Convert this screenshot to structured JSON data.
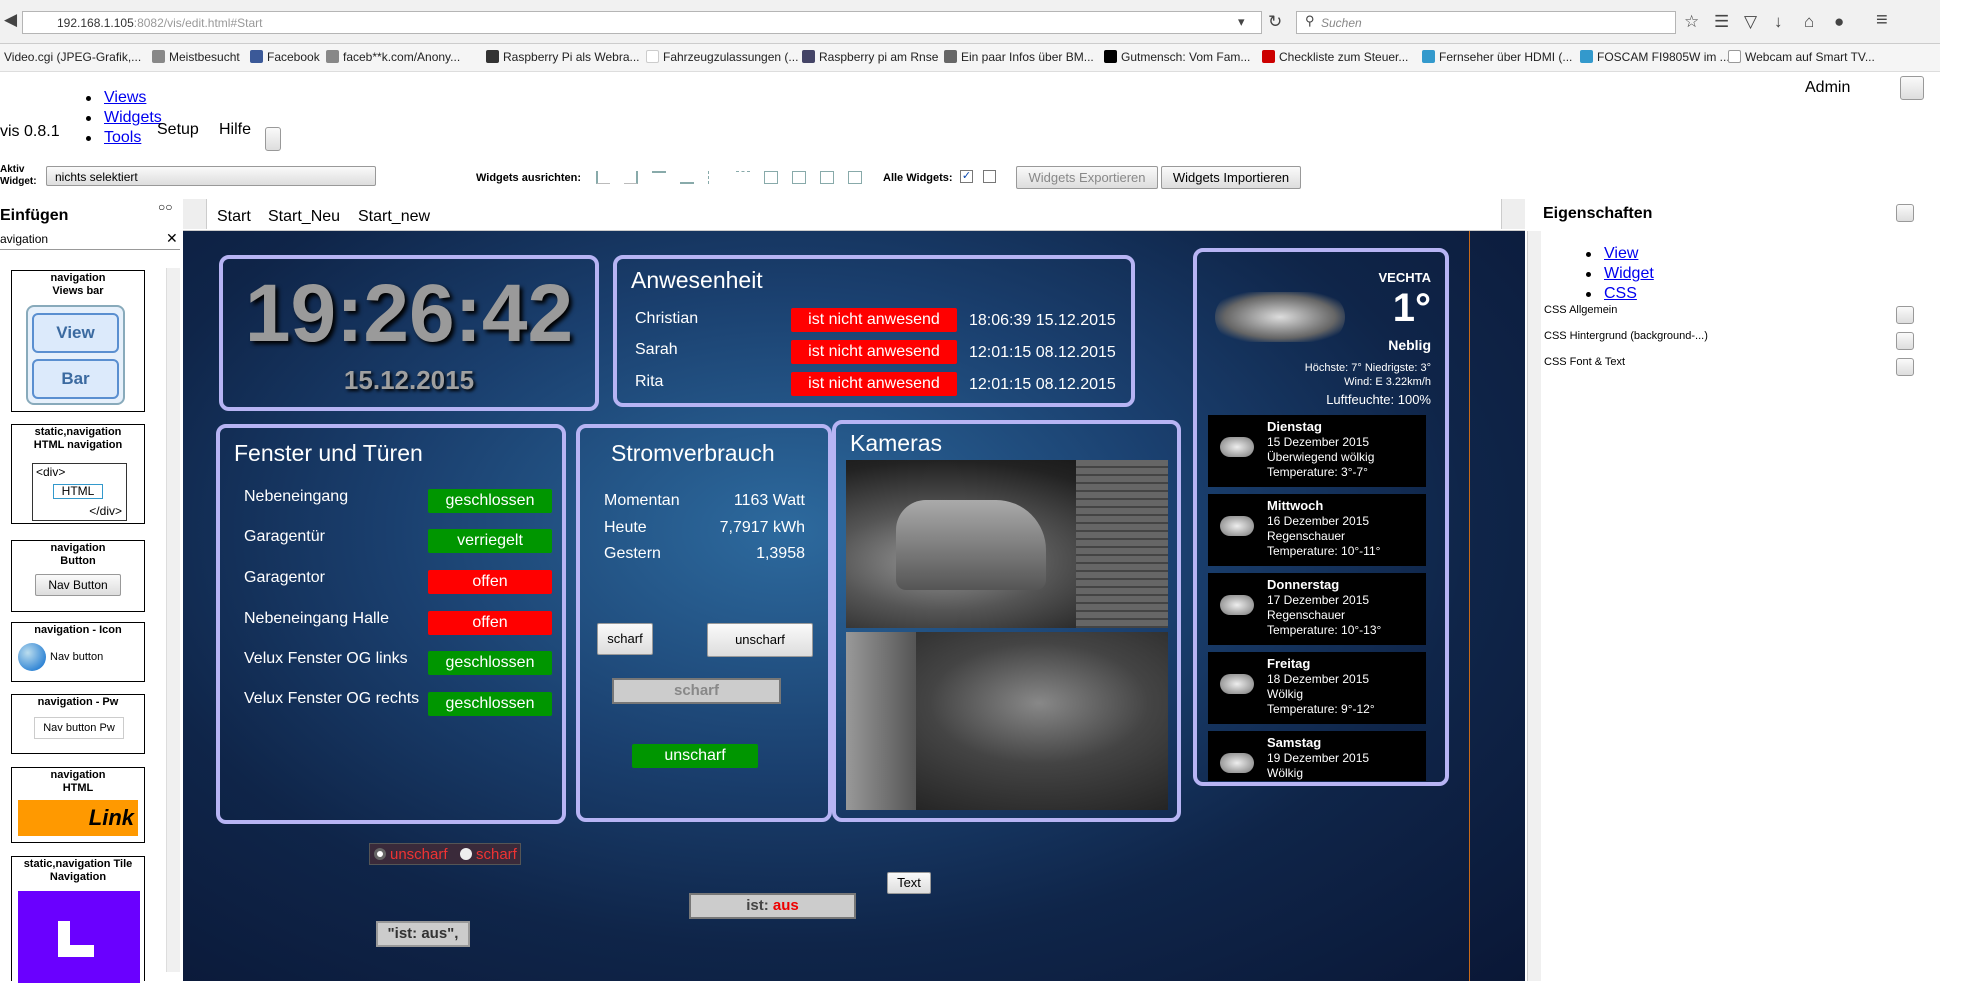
{
  "browser": {
    "url_host": "192.168.1.105",
    "url_rest": ":8082/vis/edit.html#Start",
    "search_placeholder": "Suchen",
    "bookmarks": [
      "Video.cgi (JPEG-Grafik,...",
      "Meistbesucht",
      "Facebook",
      "faceb**k.com/Anony...",
      "Raspberry Pi als Webra...",
      "Fahrzeugzulassungen (...",
      "Raspberry pi am Rnse",
      "Ein paar Infos über BM...",
      "Gutmensch: Vom Fam...",
      "Checkliste zum Steuer...",
      "Fernseher über HDMI (...",
      "FOSCAM FI9805W im ...",
      "Webcam auf Smart TV..."
    ]
  },
  "editor": {
    "menu": [
      "Views",
      "Widgets",
      "Tools"
    ],
    "version": "vis 0.8.1",
    "setup": "Setup",
    "hilfe": "Hilfe",
    "user": "Admin",
    "aktiv_label": "Aktiv Widget:",
    "aktiv_value": "nichts selektiert",
    "align_label": "Widgets ausrichten:",
    "alle_label": "Alle Widgets:",
    "export_btn": "Widgets Exportieren",
    "import_btn": "Widgets Importieren",
    "einfuegen": "Einfügen",
    "filter": "avigation",
    "view_tabs": [
      "Start",
      "Start_Neu",
      "Start_new"
    ]
  },
  "widgets_palette": [
    {
      "title": "navigation Views bar",
      "preview": [
        "View",
        "Bar"
      ]
    },
    {
      "title": "static,navigation HTML navigation",
      "preview": [
        "<div>",
        "HTML",
        "</div>"
      ]
    },
    {
      "title": "navigation Button",
      "preview": [
        "Nav Button"
      ]
    },
    {
      "title": "navigation - Icon",
      "preview": [
        "Nav button"
      ]
    },
    {
      "title": "navigation - Pw",
      "preview": [
        "Nav button Pw"
      ]
    },
    {
      "title": "navigation HTML",
      "preview": [
        "Link"
      ]
    },
    {
      "title": "static,navigation Tile Navigation",
      "preview": []
    }
  ],
  "properties": {
    "title": "Eigenschaften",
    "tabs": [
      "View",
      "Widget",
      "CSS"
    ],
    "groups": [
      "CSS Allgemein",
      "CSS Hintergrund (background-...)",
      "CSS Font & Text"
    ]
  },
  "clock": {
    "time": "19:26:42",
    "date": "15.12.2015"
  },
  "presence": {
    "title": "Anwesenheit",
    "rows": [
      {
        "name": "Christian",
        "state": "ist nicht anwesend",
        "time": "18:06:39 15.12.2015"
      },
      {
        "name": "Sarah",
        "state": "ist nicht anwesend",
        "time": "12:01:15 08.12.2015"
      },
      {
        "name": "Rita",
        "state": "ist nicht anwesend",
        "time": "12:01:15 08.12.2015"
      }
    ]
  },
  "doors": {
    "title": "Fenster und Türen",
    "rows": [
      {
        "name": "Nebeneingang",
        "state": "geschlossen",
        "color": "#009600"
      },
      {
        "name": "Garagentür",
        "state": "verriegelt",
        "color": "#009600"
      },
      {
        "name": "Garagentor",
        "state": "offen",
        "color": "#ff0000"
      },
      {
        "name": "Nebeneingang Halle",
        "state": "offen",
        "color": "#ff0000"
      },
      {
        "name": "Velux Fenster OG links",
        "state": "geschlossen",
        "color": "#009600"
      },
      {
        "name": "Velux Fenster OG rechts",
        "state": "geschlossen",
        "color": "#009600"
      }
    ]
  },
  "power": {
    "title": "Stromverbrauch",
    "rows": [
      {
        "label": "Momentan",
        "value": "1163 Watt"
      },
      {
        "label": "Heute",
        "value": "7,7917 kWh"
      },
      {
        "label": "Gestern",
        "value": "1,3958"
      }
    ],
    "btn_scharf": "scharf",
    "btn_unscharf": "unscharf",
    "state_scharf": "scharf",
    "state_unscharf": "unscharf"
  },
  "cameras": {
    "title": "Kameras"
  },
  "weather": {
    "city": "VECHTA",
    "temp": "1°",
    "condition": "Neblig",
    "minmax": "Höchste: 7° Niedrigste: 3°",
    "wind": "Wind: E 3.22km/h",
    "humidity": "Luftfeuchte: 100%",
    "forecast": [
      {
        "day": "Dienstag",
        "date": "15 Dezember 2015",
        "desc": "Überwiegend wölkig",
        "temp": "Temperature: 3°-7°"
      },
      {
        "day": "Mittwoch",
        "date": "16 Dezember 2015",
        "desc": "Regenschauer",
        "temp": "Temperature: 10°-11°"
      },
      {
        "day": "Donnerstag",
        "date": "17 Dezember 2015",
        "desc": "Regenschauer",
        "temp": "Temperature: 10°-13°"
      },
      {
        "day": "Freitag",
        "date": "18 Dezember 2015",
        "desc": "Wölkig",
        "temp": "Temperature: 9°-12°"
      },
      {
        "day": "Samstag",
        "date": "19 Dezember 2015",
        "desc": "Wölkig",
        "temp": ""
      }
    ]
  },
  "bottom": {
    "radio_unscharf": "unscharf",
    "radio_scharf": "scharf",
    "text_btn": "Text",
    "ist_label": "ist:",
    "ist_value": "aus",
    "ist_aus": "\"ist: aus\","
  }
}
